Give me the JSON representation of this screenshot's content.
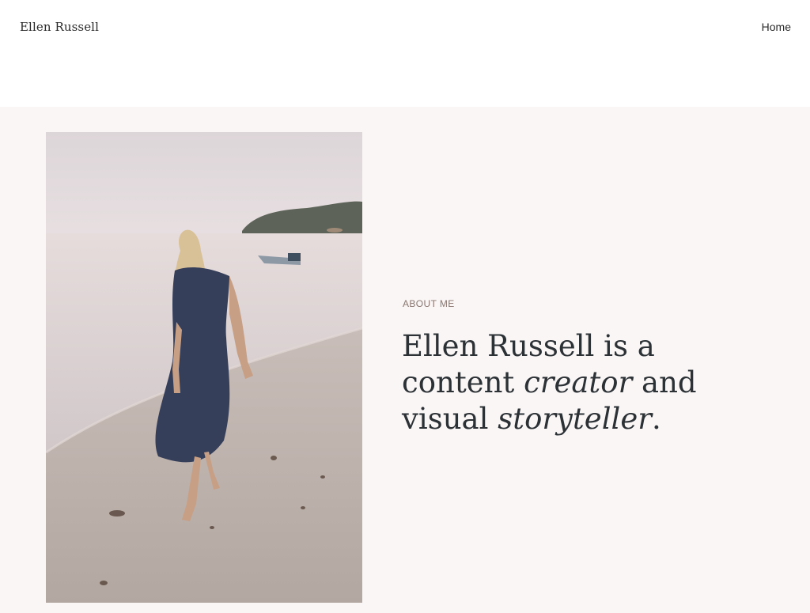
{
  "header": {
    "site_title": "Ellen Russell",
    "nav": [
      {
        "label": "Home"
      }
    ]
  },
  "hero": {
    "photo_alt": "Woman walking barefoot along a beach shoreline",
    "kicker": "ABOUT ME",
    "headline": {
      "part1": "Ellen Russell is a content ",
      "emph1": "creator",
      "part2": " and visual ",
      "emph2": "storyteller",
      "part3": "."
    }
  },
  "colors": {
    "page_bg": "#ffffff",
    "hero_bg": "#f9f6f5",
    "text_dark": "#2c3136",
    "kicker": "#8a7670"
  }
}
